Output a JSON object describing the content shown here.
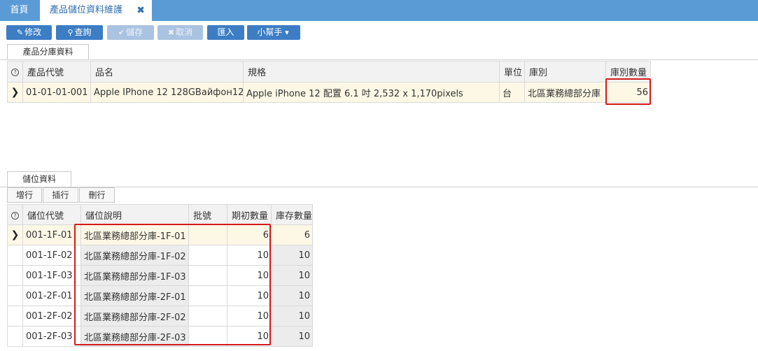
{
  "tabs": {
    "home": "首頁",
    "active": "產品儲位資料維護",
    "close": "✖"
  },
  "toolbar": {
    "edit": "修改",
    "query": "查詢",
    "save": "儲存",
    "cancel": "取消",
    "import": "匯入",
    "helper": "小幫手"
  },
  "product_section": {
    "tab_label": "產品分庫資料",
    "headers": [
      "產品代號",
      "品名",
      "規格",
      "單位",
      "庫別",
      "庫別數量"
    ],
    "rows": [
      {
        "code": "01-01-01-001",
        "name": "Apple IPhone 12 128GBайфон12",
        "spec": "Apple iPhone 12 配置 6.1 吋 2,532 x 1,170pixels",
        "unit": "台",
        "warehouse": "北區業務總部分庫",
        "qty": "56"
      }
    ]
  },
  "location_section": {
    "tab_label": "儲位資料",
    "buttons": {
      "add": "增行",
      "insert": "插行",
      "delete": "刪行"
    },
    "headers": [
      "儲位代號",
      "儲位說明",
      "批號",
      "期初數量",
      "庫存數量"
    ],
    "rows": [
      {
        "code": "001-1F-01",
        "desc": "北區業務總部分庫-1F-01",
        "batch": "",
        "initial": "6",
        "stock": "6"
      },
      {
        "code": "001-1F-02",
        "desc": "北區業務總部分庫-1F-02",
        "batch": "",
        "initial": "10",
        "stock": "10"
      },
      {
        "code": "001-1F-03",
        "desc": "北區業務總部分庫-1F-03",
        "batch": "",
        "initial": "10",
        "stock": "10"
      },
      {
        "code": "001-2F-01",
        "desc": "北區業務總部分庫-2F-01",
        "batch": "",
        "initial": "10",
        "stock": "10"
      },
      {
        "code": "001-2F-02",
        "desc": "北區業務總部分庫-2F-02",
        "batch": "",
        "initial": "10",
        "stock": "10"
      },
      {
        "code": "001-2F-03",
        "desc": "北區業務總部分庫-2F-03",
        "batch": "",
        "initial": "10",
        "stock": "10"
      }
    ]
  },
  "colors": {
    "tabbar": "#5b9bd5",
    "button": "#3c7dc4",
    "button_disabled": "#a9c3e0",
    "current_row": "#fdf8e6",
    "highlight": "#d21b1b"
  }
}
